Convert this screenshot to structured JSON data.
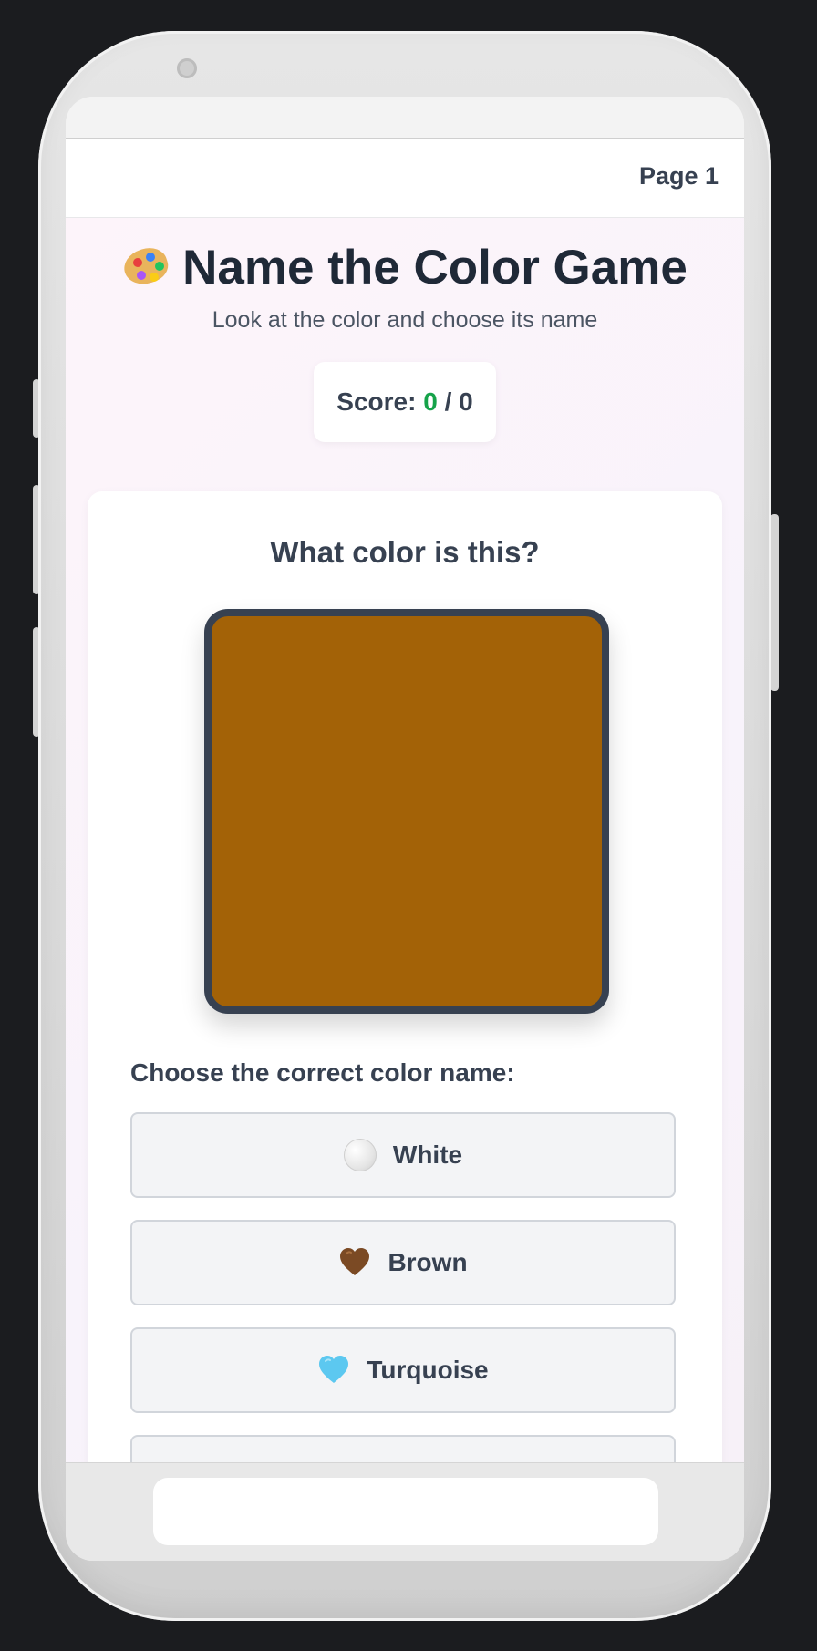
{
  "header": {
    "page_indicator": "Page 1"
  },
  "game": {
    "title": "Name the Color Game",
    "title_icon": "artist-palette-icon",
    "subtitle": "Look at the color and choose its name",
    "score": {
      "label": "Score: ",
      "correct": "0",
      "separator": " / ",
      "total": "0"
    },
    "question": "What color is this?",
    "swatch_color": "#a36207",
    "choose_label": "Choose the correct color name:",
    "options": [
      {
        "label": "White",
        "icon": "white-circle-icon"
      },
      {
        "label": "Brown",
        "icon": "brown-heart-icon",
        "icon_color": "#7b4a24"
      },
      {
        "label": "Turquoise",
        "icon": "light-blue-heart-icon",
        "icon_color": "#5cc8f0"
      },
      {
        "label": ""
      }
    ]
  },
  "colors": {
    "score_correct": "#16a34a",
    "text_dark": "#1f2937",
    "swatch_border": "#374151"
  }
}
